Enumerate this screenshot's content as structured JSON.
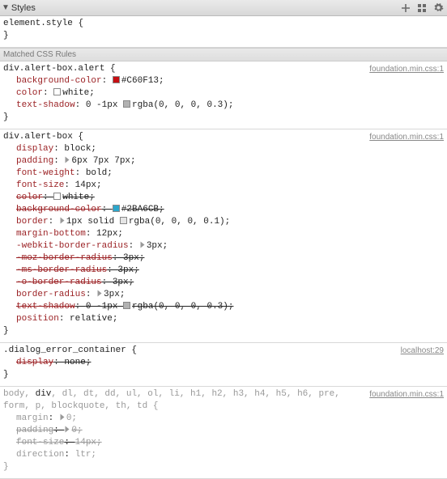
{
  "header": {
    "title": "Styles"
  },
  "element_style": {
    "selector": "element.style",
    "open": "{",
    "close": "}"
  },
  "matched_label": "Matched CSS Rules",
  "rules": [
    {
      "selector": "div.alert-box.alert {",
      "source": "foundation.min.css:1",
      "decls": [
        {
          "prop": "background-color",
          "val_prefix": "",
          "swatch": "#C60F13",
          "val": "#C60F13;",
          "strike": false
        },
        {
          "prop": "color",
          "val_prefix": "",
          "swatch": "#ffffff",
          "val": "white;",
          "strike": false
        },
        {
          "prop": "text-shadow",
          "val_prefix": "0 -1px ",
          "swatch": "rgba(0,0,0,0.3)",
          "val": "rgba(0, 0, 0, 0.3);",
          "strike": false
        }
      ],
      "close": "}"
    },
    {
      "selector": "div.alert-box {",
      "source": "foundation.min.css:1",
      "decls": [
        {
          "prop": "display",
          "val": "block;",
          "strike": false
        },
        {
          "prop": "padding",
          "tri": true,
          "val": "6px 7px 7px;",
          "strike": false
        },
        {
          "prop": "font-weight",
          "val": "bold;",
          "strike": false
        },
        {
          "prop": "font-size",
          "val": "14px;",
          "strike": false
        },
        {
          "prop": "color",
          "swatch": "#ffffff",
          "val": "white;",
          "strike": true
        },
        {
          "prop": "background-color",
          "swatch": "#2BA6CB",
          "val": "#2BA6CB;",
          "strike": true
        },
        {
          "prop": "border",
          "tri": true,
          "val_prefix": "1px solid ",
          "swatch": "rgba(0,0,0,0.1)",
          "val": "rgba(0, 0, 0, 0.1);",
          "strike": false
        },
        {
          "prop": "margin-bottom",
          "val": "12px;",
          "strike": false
        },
        {
          "prop": "-webkit-border-radius",
          "tri": true,
          "val": "3px;",
          "strike": false
        },
        {
          "prop": "-moz-border-radius",
          "val": "3px;",
          "strike": true,
          "warn": true
        },
        {
          "prop": "-ms-border-radius",
          "val": "3px;",
          "strike": true,
          "warn": true
        },
        {
          "prop": "-o-border-radius",
          "val": "3px;",
          "strike": true,
          "warn": true
        },
        {
          "prop": "border-radius",
          "tri": true,
          "val": "3px;",
          "strike": false
        },
        {
          "prop": "text-shadow",
          "val_prefix": "0 -1px ",
          "swatch": "rgba(0,0,0,0.3)",
          "val": "rgba(0, 0, 0, 0.3);",
          "strike": true
        },
        {
          "prop": "position",
          "val": "relative;",
          "strike": false
        }
      ],
      "close": "}"
    },
    {
      "selector": ".dialog_error_container {",
      "source": "localhost:29",
      "decls": [
        {
          "prop": "display",
          "val": "none;",
          "strike": true
        }
      ],
      "close": "}"
    },
    {
      "gray": true,
      "selector_html": "body, <hl>div</hl>, dl, dt, dd, ul, ol, li, h1, h2, h3, h4, h5, h6, pre, form, p, blockquote, th, td {",
      "source": "foundation.min.css:1",
      "decls": [
        {
          "prop": "margin",
          "tri": true,
          "val": "0;",
          "strike": false
        },
        {
          "prop": "padding",
          "tri": true,
          "val": "0;",
          "strike": true
        },
        {
          "prop": "font-size",
          "val": "14px;",
          "strike": true
        },
        {
          "prop": "direction",
          "val": "ltr;",
          "strike": false
        }
      ],
      "close": "}"
    }
  ]
}
